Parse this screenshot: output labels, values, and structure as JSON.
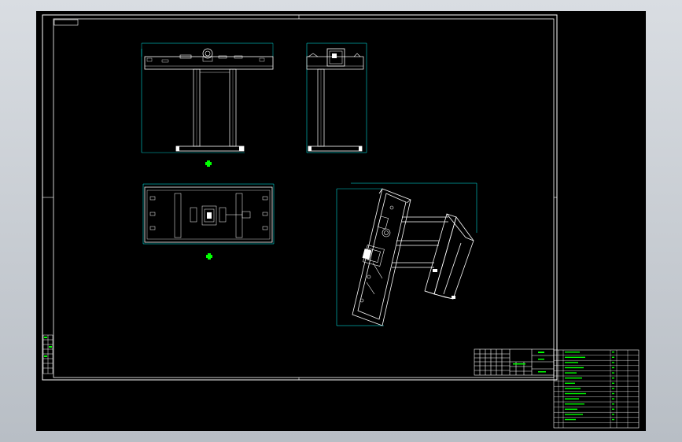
{
  "drawing": {
    "title_tag": "",
    "views": {
      "front": {
        "dim_width": "",
        "dim_height": ""
      },
      "side": {
        "dim_height": ""
      },
      "top": {
        "dim_width": ""
      },
      "iso": {
        "dim_width": "",
        "dim_height": ""
      }
    }
  },
  "colors": {
    "background": "#000000",
    "frame": "#ffffff",
    "dimension": "#00ffff",
    "marker": "#00ff00",
    "viewport_border": "#c8ccd2"
  },
  "bom": {
    "rows": 14
  }
}
